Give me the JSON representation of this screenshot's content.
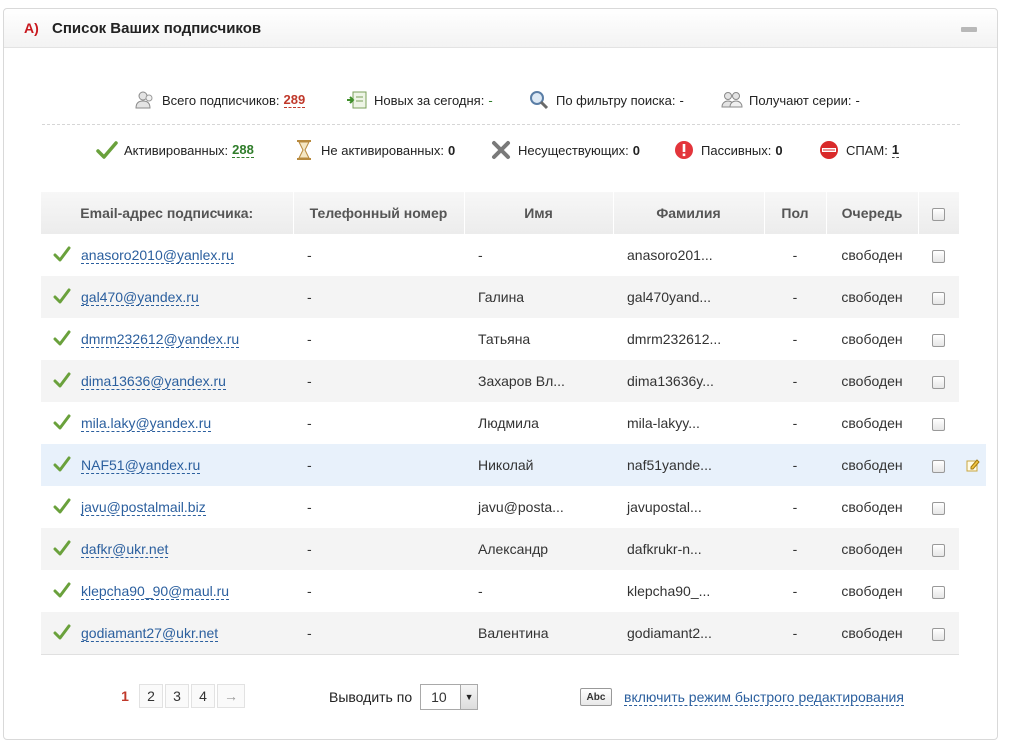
{
  "panel": {
    "letter": "A)",
    "title": "Список Ваших подписчиков"
  },
  "stats_top": [
    {
      "label": "Всего подписчиков:",
      "value": "289",
      "icon": "users-icon"
    },
    {
      "label": "Новых за сегодня:",
      "value": "-",
      "icon": "new-user-icon"
    },
    {
      "label": "По фильтру поиска:",
      "value": "-",
      "icon": "magnifier-icon"
    },
    {
      "label": "Получают серии:",
      "value": "-",
      "icon": "group-icon"
    }
  ],
  "stats_bottom": [
    {
      "label": "Активированных:",
      "value": "288",
      "icon": "checkmark-icon"
    },
    {
      "label": "Не активированных:",
      "value": "0",
      "icon": "hourglass-icon"
    },
    {
      "label": "Несуществующих:",
      "value": "0",
      "icon": "cross-icon"
    },
    {
      "label": "Пассивных:",
      "value": "0",
      "icon": "alert-icon"
    },
    {
      "label": "СПАМ:",
      "value": "1",
      "icon": "spam-icon"
    }
  ],
  "table": {
    "headers": [
      "Email-адрес подписчика:",
      "Телефонный номер",
      "Имя",
      "Фамилия",
      "Пол",
      "Очередь"
    ],
    "rows": [
      {
        "email": "anasoro2010@yanlex.ru",
        "phone": "-",
        "name": "-",
        "surname": "anasoro201...",
        "gender": "-",
        "queue": "свободен"
      },
      {
        "email": "gal470@yandex.ru",
        "phone": "-",
        "name": "Галина",
        "surname": "gal470yand...",
        "gender": "-",
        "queue": "свободен"
      },
      {
        "email": "dmrm232612@yandex.ru",
        "phone": "-",
        "name": "Татьяна",
        "surname": "dmrm232612...",
        "gender": "-",
        "queue": "свободен"
      },
      {
        "email": "dima13636@yandex.ru",
        "phone": "-",
        "name": "Захаров Вл...",
        "surname": "dima13636y...",
        "gender": "-",
        "queue": "свободен"
      },
      {
        "email": "mila.laky@yandex.ru",
        "phone": "-",
        "name": "Людмила",
        "surname": "mila-lakyy...",
        "gender": "-",
        "queue": "свободен"
      },
      {
        "email": "NAF51@yandex.ru",
        "phone": "-",
        "name": "Николай",
        "surname": "naf51yande...",
        "gender": "-",
        "queue": "свободен"
      },
      {
        "email": "javu@postalmail.biz",
        "phone": "-",
        "name": "javu@posta...",
        "surname": "javupostal...",
        "gender": "-",
        "queue": "свободен"
      },
      {
        "email": "dafkr@ukr.net",
        "phone": "-",
        "name": "Александр",
        "surname": "dafkrukr-n...",
        "gender": "-",
        "queue": "свободен"
      },
      {
        "email": "klepcha90_90@maul.ru",
        "phone": "-",
        "name": "-",
        "surname": "klepcha90_...",
        "gender": "-",
        "queue": "свободен"
      },
      {
        "email": "godiamant27@ukr.net",
        "phone": "-",
        "name": "Валентина",
        "surname": "godiamant2...",
        "gender": "-",
        "queue": "свободен"
      }
    ]
  },
  "pagination": {
    "pages": [
      "1",
      "2",
      "3",
      "4"
    ],
    "next": "→",
    "current": "1"
  },
  "per_page": {
    "label": "Выводить по",
    "value": "10"
  },
  "quick_edit": {
    "icon_text": "Abc",
    "label": "включить режим быстрого редактирования"
  }
}
